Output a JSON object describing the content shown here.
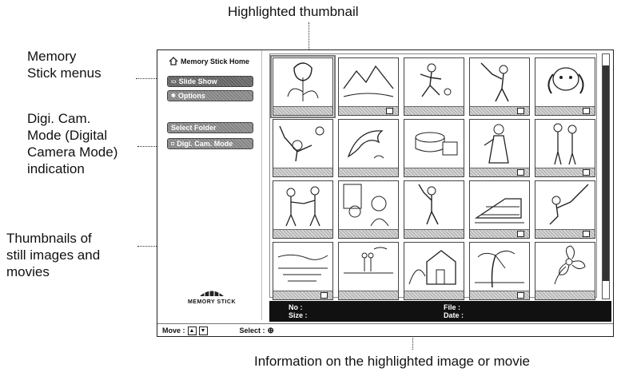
{
  "callouts": {
    "highlighted_thumbnail": "Highlighted thumbnail",
    "memory_stick_menus": [
      "Memory",
      "Stick menus"
    ],
    "digi_cam_mode": [
      "Digi. Cam.",
      "Mode (Digital",
      "Camera Mode)",
      "indication"
    ],
    "thumbnails": [
      "Thumbnails of",
      "still images and",
      "movies"
    ],
    "info": "Information on the highlighted image or movie"
  },
  "menu": {
    "home_label": "Memory Stick Home",
    "items": [
      {
        "label": "Slide Show",
        "icon": "slideshow-icon"
      },
      {
        "label": "Options",
        "icon": "options-icon"
      },
      {
        "label": "Select Folder",
        "icon": ""
      },
      {
        "label": "Digi. Cam. Mode",
        "icon": "camera-icon"
      }
    ],
    "logo_text": "MEMORY STICK"
  },
  "thumbnails": [
    {
      "subject": "tulip-icon",
      "movie": false
    },
    {
      "subject": "landscape-icon",
      "movie": true
    },
    {
      "subject": "soccer-player-icon",
      "movie": false
    },
    {
      "subject": "batter-icon",
      "movie": true
    },
    {
      "subject": "dog-icon",
      "movie": true
    },
    {
      "subject": "volleyball-icon",
      "movie": false
    },
    {
      "subject": "dolphin-icon",
      "movie": false
    },
    {
      "subject": "cake-icon",
      "movie": false
    },
    {
      "subject": "woman-icon",
      "movie": true
    },
    {
      "subject": "couple-icon",
      "movie": true
    },
    {
      "subject": "boxers-icon",
      "movie": false
    },
    {
      "subject": "window-people-icon",
      "movie": false
    },
    {
      "subject": "golfer-icon",
      "movie": false
    },
    {
      "subject": "train-icon",
      "movie": true
    },
    {
      "subject": "fisher-icon",
      "movie": true
    },
    {
      "subject": "seascape-icon",
      "movie": true
    },
    {
      "subject": "beach-couple-icon",
      "movie": false
    },
    {
      "subject": "house-icon",
      "movie": false
    },
    {
      "subject": "palm-icon",
      "movie": true
    },
    {
      "subject": "flower-icon",
      "movie": false
    }
  ],
  "info_bar": {
    "no": "No :",
    "size": "Size :",
    "file": "File :",
    "date": "Date :"
  },
  "status_bar": {
    "move": "Move :",
    "select": "Select :"
  }
}
